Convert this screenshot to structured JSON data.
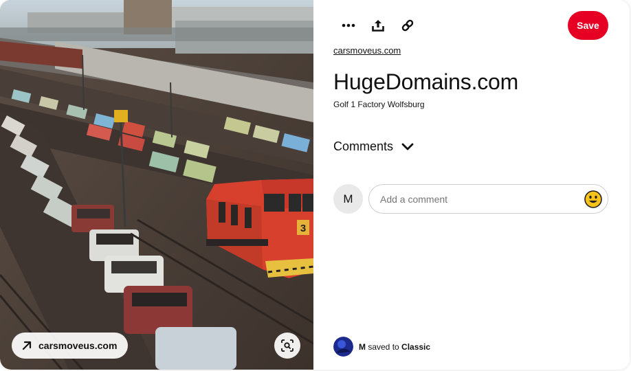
{
  "image": {
    "source_chip_label": "carsmoveus.com",
    "alt": "Golf 1 Factory Wolfsburg",
    "loco_number": "3"
  },
  "toolbar": {
    "more_icon": "more-horizontal-icon",
    "share_icon": "share-upload-icon",
    "link_icon": "link-icon",
    "save_label": "Save",
    "save_color": "#e60023"
  },
  "pin": {
    "source_domain": "carsmoveus.com",
    "title": "HugeDomains.com",
    "description": "Golf 1 Factory Wolfsburg"
  },
  "comments": {
    "header_label": "Comments",
    "avatar_initial": "M",
    "input_placeholder": "Add a comment",
    "emoji_icon": "smiley-emoji-icon"
  },
  "saved_to": {
    "user": "M",
    "middle_text": " saved to ",
    "board": "Classic"
  }
}
